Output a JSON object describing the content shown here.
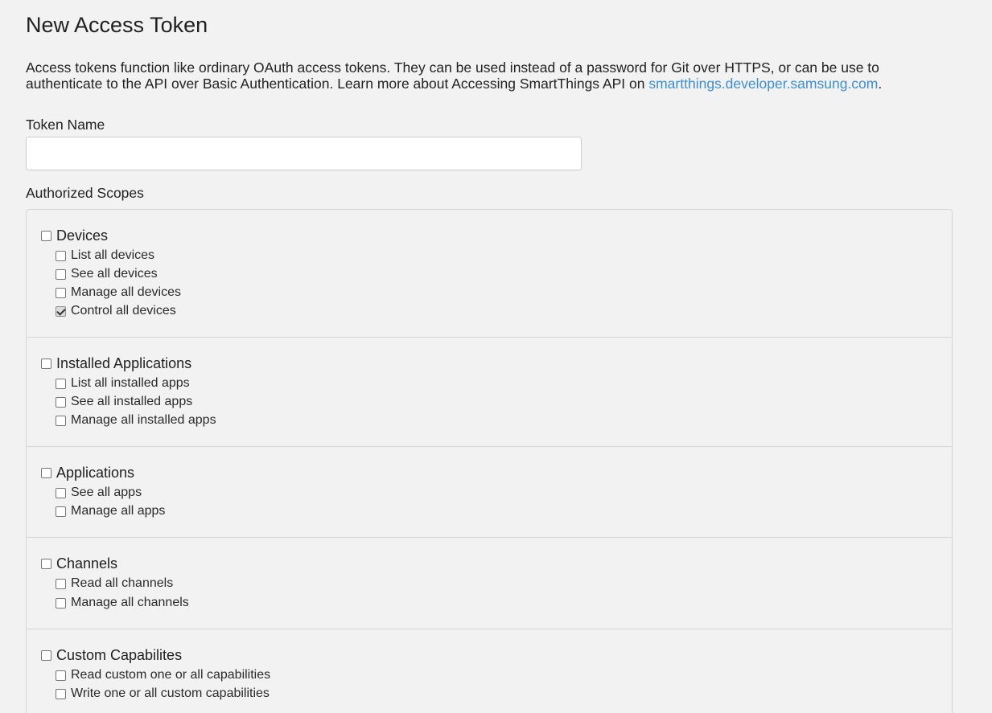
{
  "page": {
    "title": "New Access Token",
    "description_text": "Access tokens function like ordinary OAuth access tokens. They can be used instead of a password for Git over HTTPS, or can be use to authenticate to the API over Basic Authentication. Learn more about Accessing SmartThings API on ",
    "description_link": "smartthings.developer.samsung.com",
    "description_end": "."
  },
  "token_name": {
    "label": "Token Name",
    "value": "",
    "placeholder": ""
  },
  "scopes": {
    "label": "Authorized Scopes",
    "groups": [
      {
        "label": "Devices",
        "checked": false,
        "items": [
          {
            "label": "List all devices",
            "checked": false
          },
          {
            "label": "See all devices",
            "checked": false
          },
          {
            "label": "Manage all devices",
            "checked": false
          },
          {
            "label": "Control all devices",
            "checked": true
          }
        ]
      },
      {
        "label": "Installed Applications",
        "checked": false,
        "items": [
          {
            "label": "List all installed apps",
            "checked": false
          },
          {
            "label": "See all installed apps",
            "checked": false
          },
          {
            "label": "Manage all installed apps",
            "checked": false
          }
        ]
      },
      {
        "label": "Applications",
        "checked": false,
        "items": [
          {
            "label": "See all apps",
            "checked": false
          },
          {
            "label": "Manage all apps",
            "checked": false
          }
        ]
      },
      {
        "label": "Channels",
        "checked": false,
        "items": [
          {
            "label": "Read all channels",
            "checked": false
          },
          {
            "label": "Manage all channels",
            "checked": false
          }
        ]
      },
      {
        "label": "Custom Capabilites",
        "checked": false,
        "items": [
          {
            "label": "Read custom one or all capabilities",
            "checked": false
          },
          {
            "label": "Write one or all custom capabilities",
            "checked": false
          }
        ]
      }
    ]
  }
}
